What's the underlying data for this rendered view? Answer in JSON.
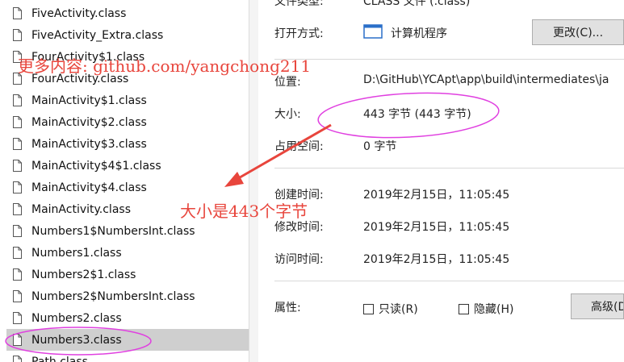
{
  "file_list": [
    {
      "name": "FiveActivity.class"
    },
    {
      "name": "FiveActivity_Extra.class"
    },
    {
      "name": "FourActivity$1.class"
    },
    {
      "name": "FourActivity.class"
    },
    {
      "name": "MainActivity$1.class"
    },
    {
      "name": "MainActivity$2.class"
    },
    {
      "name": "MainActivity$3.class"
    },
    {
      "name": "MainActivity$4$1.class"
    },
    {
      "name": "MainActivity$4.class"
    },
    {
      "name": "MainActivity.class"
    },
    {
      "name": "Numbers1$NumbersInt.class"
    },
    {
      "name": "Numbers1.class"
    },
    {
      "name": "Numbers2$1.class"
    },
    {
      "name": "Numbers2$NumbersInt.class"
    },
    {
      "name": "Numbers2.class"
    },
    {
      "name": "Numbers3.class",
      "selected": true
    },
    {
      "name": "Path.class"
    }
  ],
  "properties": {
    "type_label": "文件类型:",
    "type_value": "CLASS 文件 (.class)",
    "open_with_label": "打开方式:",
    "open_with_value": "计算机程序",
    "change_button": "更改(C)...",
    "location_label": "位置:",
    "location_value": "D:\\GitHub\\YCApt\\app\\build\\intermediates\\ja",
    "size_label": "大小:",
    "size_value": "443 字节 (443 字节)",
    "disk_size_label": "占用空间:",
    "disk_size_value": "0 字节",
    "created_label": "创建时间:",
    "created_value": "2019年2月15日，11:05:45",
    "modified_label": "修改时间:",
    "modified_value": "2019年2月15日，11:05:45",
    "accessed_label": "访问时间:",
    "accessed_value": "2019年2月15日，11:05:45",
    "attributes_label": "属性:",
    "readonly_label": "只读(R)",
    "hidden_label": "隐藏(H)",
    "advanced_button": "高级(D"
  },
  "annotations": {
    "watermark": "更多内容: github.com/yangchong211",
    "size_note": "大小是443个字节",
    "color": "#e8453c",
    "highlight_color": "#e040e0"
  }
}
